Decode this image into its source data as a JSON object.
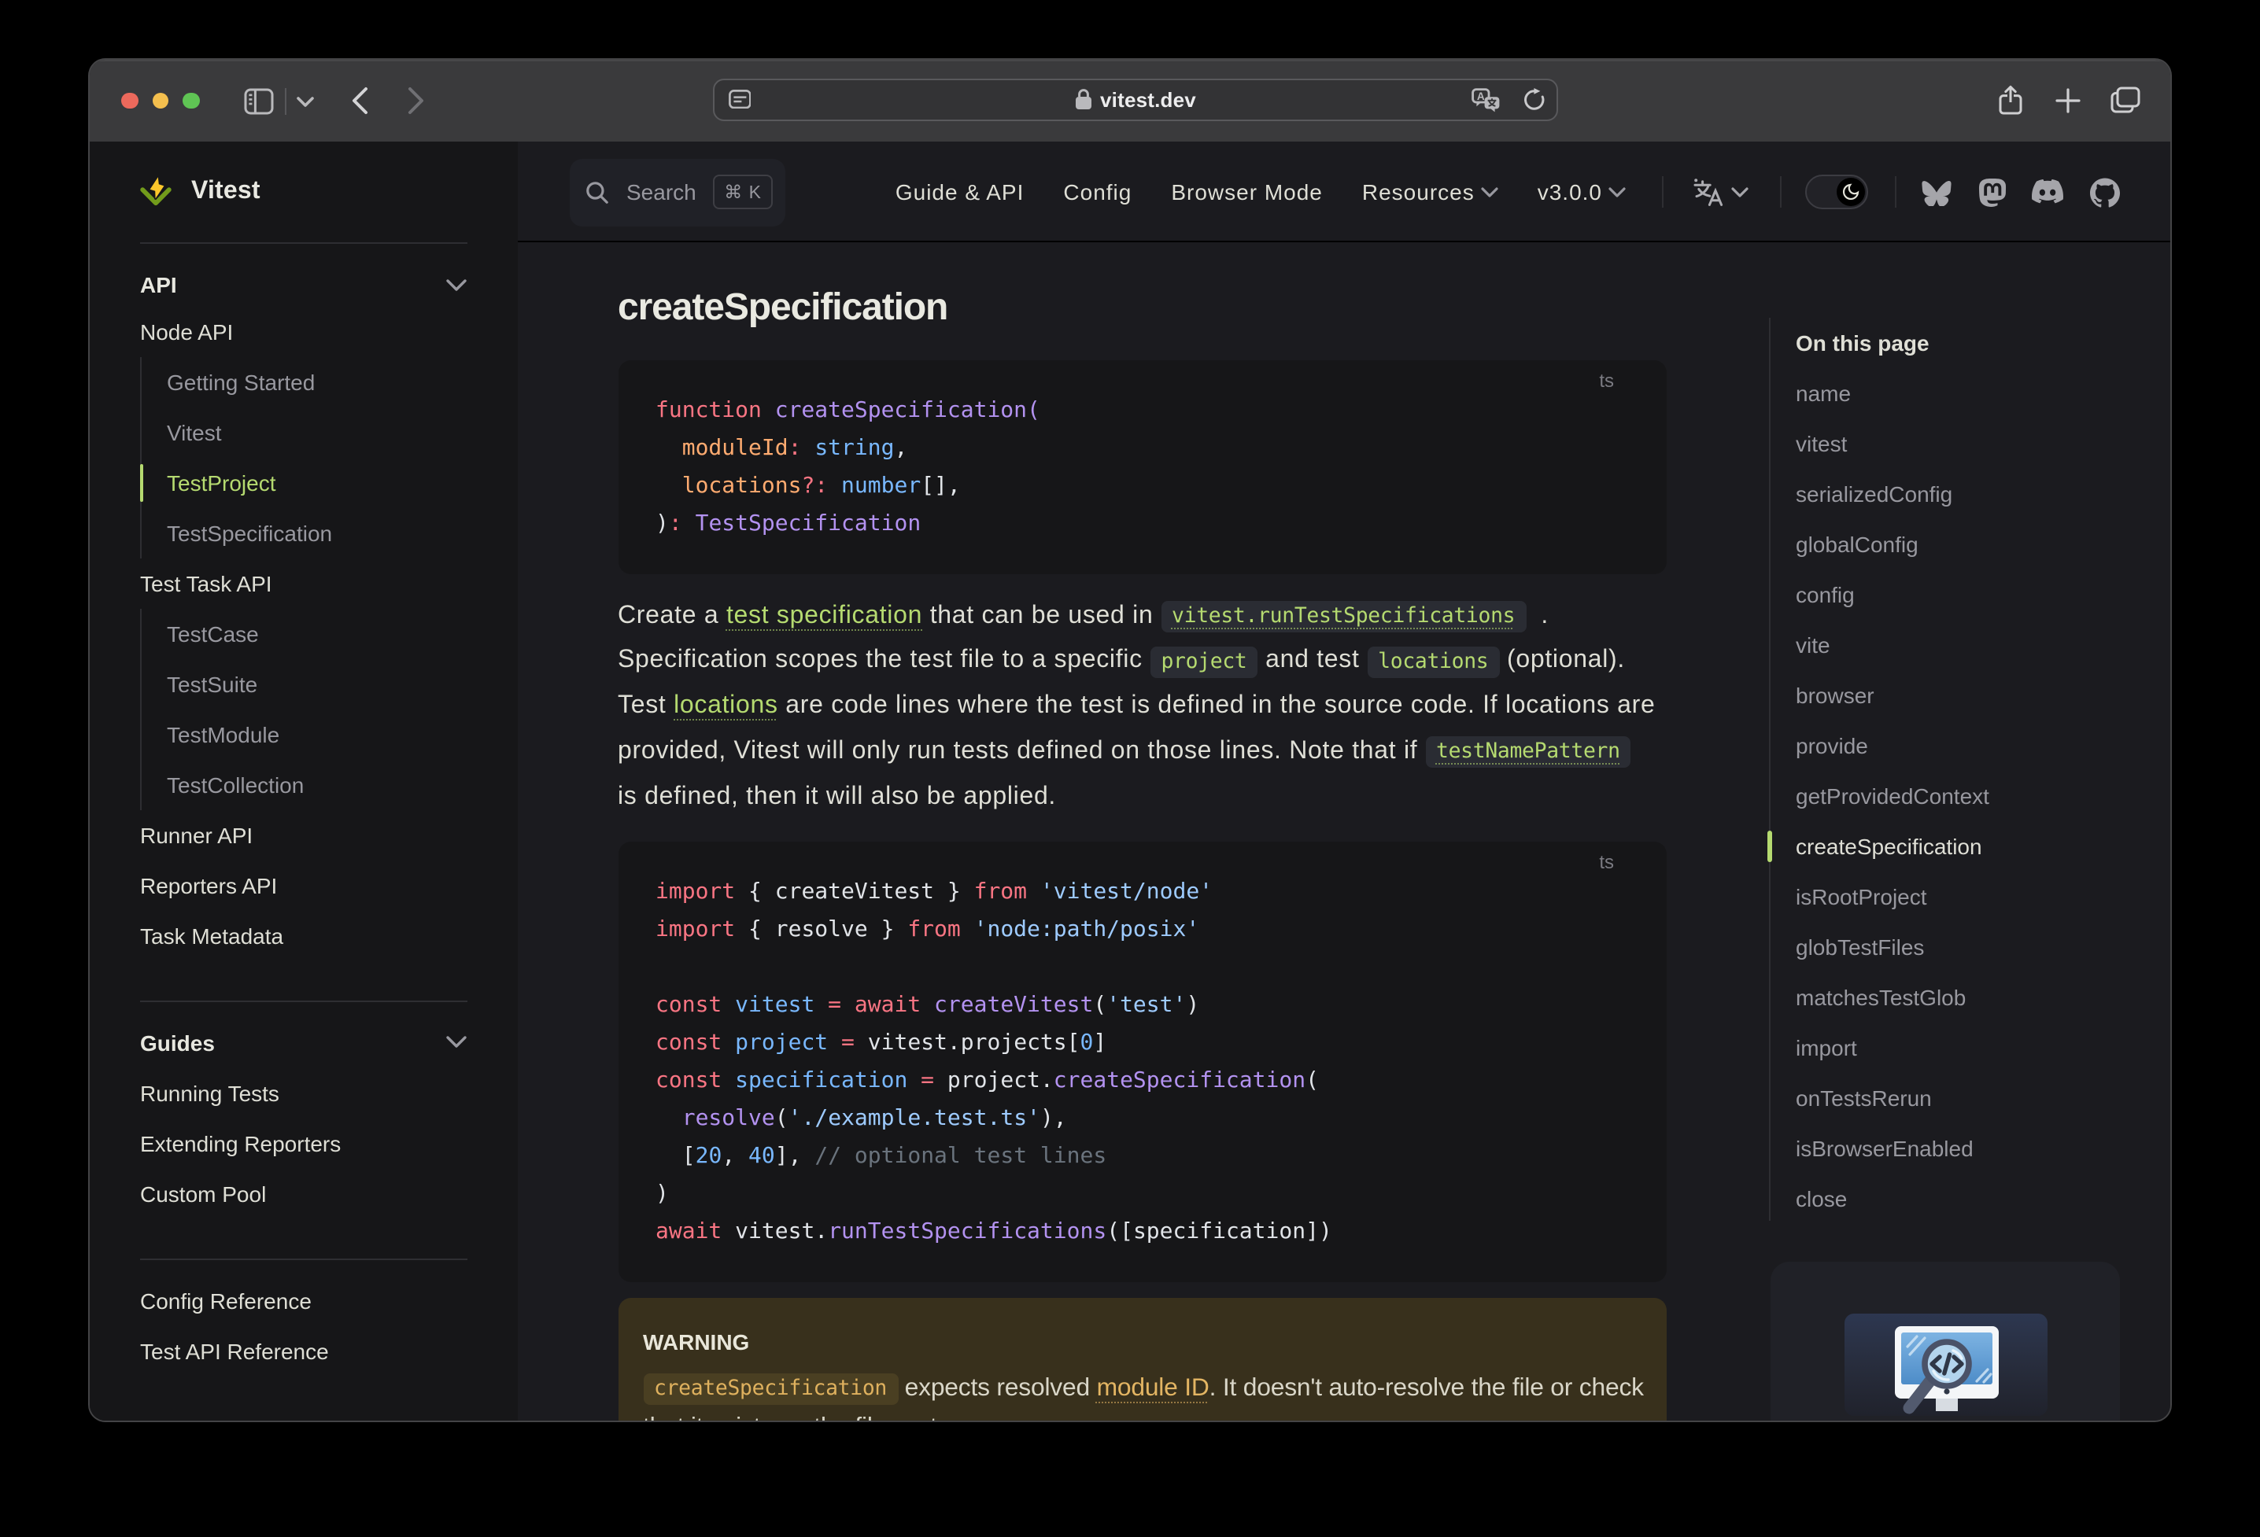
{
  "browser": {
    "url": "vitest.dev"
  },
  "nav": {
    "logo_text": "Vitest",
    "search_label": "Search",
    "search_shortcut": "⌘ K",
    "links": [
      {
        "label": "Guide & API",
        "chevron": false
      },
      {
        "label": "Config",
        "chevron": false
      },
      {
        "label": "Browser Mode",
        "chevron": false
      },
      {
        "label": "Resources",
        "chevron": true
      },
      {
        "label": "v3.0.0",
        "chevron": true
      }
    ],
    "social_icons": [
      "bluesky",
      "mastodon",
      "discord",
      "github"
    ]
  },
  "sidebar": {
    "sections": [
      {
        "title": "API",
        "chevron": true,
        "rows": [
          {
            "label": "Node API",
            "children": [
              "Getting Started",
              "Vitest",
              "TestProject",
              "TestSpecification"
            ],
            "active_child": "TestProject"
          },
          {
            "label": "Test Task API",
            "children": [
              "TestCase",
              "TestSuite",
              "TestModule",
              "TestCollection"
            ]
          },
          {
            "label": "Runner API"
          },
          {
            "label": "Reporters API"
          },
          {
            "label": "Task Metadata"
          }
        ]
      },
      {
        "title": "Guides",
        "chevron": true,
        "rows": [
          {
            "label": "Running Tests"
          },
          {
            "label": "Extending Reporters"
          },
          {
            "label": "Custom Pool"
          }
        ]
      },
      {
        "rows": [
          {
            "label": "Config Reference"
          },
          {
            "label": "Test API Reference"
          }
        ]
      }
    ]
  },
  "content": {
    "title": "createSpecification",
    "code_blocks": [
      {
        "lang": "ts",
        "lines": [
          [
            [
              "k",
              "function "
            ],
            [
              "f",
              "createSpecification("
            ]
          ],
          [
            [
              "d",
              "  "
            ],
            [
              "p",
              "moduleId"
            ],
            [
              "k",
              ": "
            ],
            [
              "t",
              "string"
            ],
            [
              "d",
              ","
            ]
          ],
          [
            [
              "d",
              "  "
            ],
            [
              "p",
              "locations"
            ],
            [
              "k",
              "?: "
            ],
            [
              "t",
              "number"
            ],
            [
              "d",
              "[],"
            ]
          ],
          [
            [
              "d",
              ")"
            ],
            [
              "k",
              ": "
            ],
            [
              "f",
              "TestSpecification"
            ]
          ]
        ]
      },
      {
        "lang": "ts",
        "lines": [
          [
            [
              "k",
              "import"
            ],
            [
              "d",
              " { createVitest } "
            ],
            [
              "k",
              "from"
            ],
            [
              "s",
              " 'vitest/node'"
            ]
          ],
          [
            [
              "k",
              "import"
            ],
            [
              "d",
              " { resolve } "
            ],
            [
              "k",
              "from"
            ],
            [
              "s",
              " 'node:path/posix'"
            ]
          ],
          [],
          [
            [
              "k",
              "const "
            ],
            [
              "t",
              "vitest"
            ],
            [
              "k",
              " = await "
            ],
            [
              "f",
              "createVitest"
            ],
            [
              "d",
              "("
            ],
            [
              "s",
              "'test'"
            ],
            [
              "d",
              ")"
            ]
          ],
          [
            [
              "k",
              "const "
            ],
            [
              "t",
              "project"
            ],
            [
              "k",
              " = "
            ],
            [
              "d",
              "vitest.projects["
            ],
            [
              "n",
              "0"
            ],
            [
              "d",
              "]"
            ]
          ],
          [
            [
              "k",
              "const "
            ],
            [
              "t",
              "specification"
            ],
            [
              "k",
              " = "
            ],
            [
              "d",
              "project."
            ],
            [
              "f",
              "createSpecification"
            ],
            [
              "d",
              "("
            ]
          ],
          [
            [
              "d",
              "  "
            ],
            [
              "f",
              "resolve"
            ],
            [
              "d",
              "("
            ],
            [
              "s",
              "'./example.test.ts'"
            ],
            [
              "d",
              "),"
            ]
          ],
          [
            [
              "d",
              "  ["
            ],
            [
              "n",
              "20"
            ],
            [
              "d",
              ", "
            ],
            [
              "n",
              "40"
            ],
            [
              "d",
              "], "
            ],
            [
              "c",
              "// optional test lines"
            ]
          ],
          [
            [
              "d",
              ")"
            ]
          ],
          [
            [
              "k",
              "await "
            ],
            [
              "d",
              "vitest."
            ],
            [
              "f",
              "runTestSpecifications"
            ],
            [
              "d",
              "(["
            ],
            [
              "d",
              "specification"
            ],
            [
              "d",
              "])"
            ]
          ]
        ]
      }
    ],
    "paragraph_lines": [
      [
        {
          "t": "Create a "
        },
        {
          "c": "link",
          "t": "test specification"
        },
        {
          "t": " that can be used in "
        },
        {
          "c": "codelink",
          "t": "vitest.runTestSpecifications"
        },
        {
          "t": "  ."
        }
      ],
      [
        {
          "t": "Specification scopes the test file to a specific "
        },
        {
          "c": "code",
          "t": "project"
        },
        {
          "t": " and test "
        },
        {
          "c": "code",
          "t": "locations"
        },
        {
          "t": " (optional)."
        }
      ],
      [
        {
          "t": "Test "
        },
        {
          "c": "link",
          "t": "locations"
        },
        {
          "t": " are code lines where the test is defined in the source code. If locations are"
        }
      ],
      [
        {
          "t": "provided, Vitest will only run tests defined on those lines. Note that if "
        },
        {
          "c": "codelink",
          "t": "testNamePattern"
        }
      ],
      [
        {
          "t": "is defined, then it will also be applied."
        }
      ]
    ],
    "warning": {
      "title": "WARNING",
      "lines": [
        [
          {
            "c": "wcode",
            "t": "createSpecification"
          },
          {
            "t": " expects resolved "
          },
          {
            "c": "wlink",
            "t": "module ID"
          },
          {
            "t": ". It doesn't auto-resolve the file or check"
          }
        ],
        [
          {
            "t": "that it exists on the file system."
          }
        ]
      ]
    }
  },
  "aside": {
    "title": "On this page",
    "items": [
      "name",
      "vitest",
      "serializedConfig",
      "globalConfig",
      "config",
      "vite",
      "browser",
      "provide",
      "getProvidedContext",
      "createSpecification",
      "isRootProject",
      "globTestFiles",
      "matchesTestGlob",
      "import",
      "onTestsRerun",
      "isBrowserEnabled",
      "close"
    ],
    "active_item": "createSpecification"
  },
  "colors": {
    "brand_green": "#b5da70",
    "logo_yellow": "#fcc72b",
    "logo_green": "#729b1b",
    "warning_amber": "#dfb15e",
    "traffic_red": "#ec695c",
    "traffic_yellow": "#f4bf4e",
    "traffic_green": "#5fc454"
  }
}
